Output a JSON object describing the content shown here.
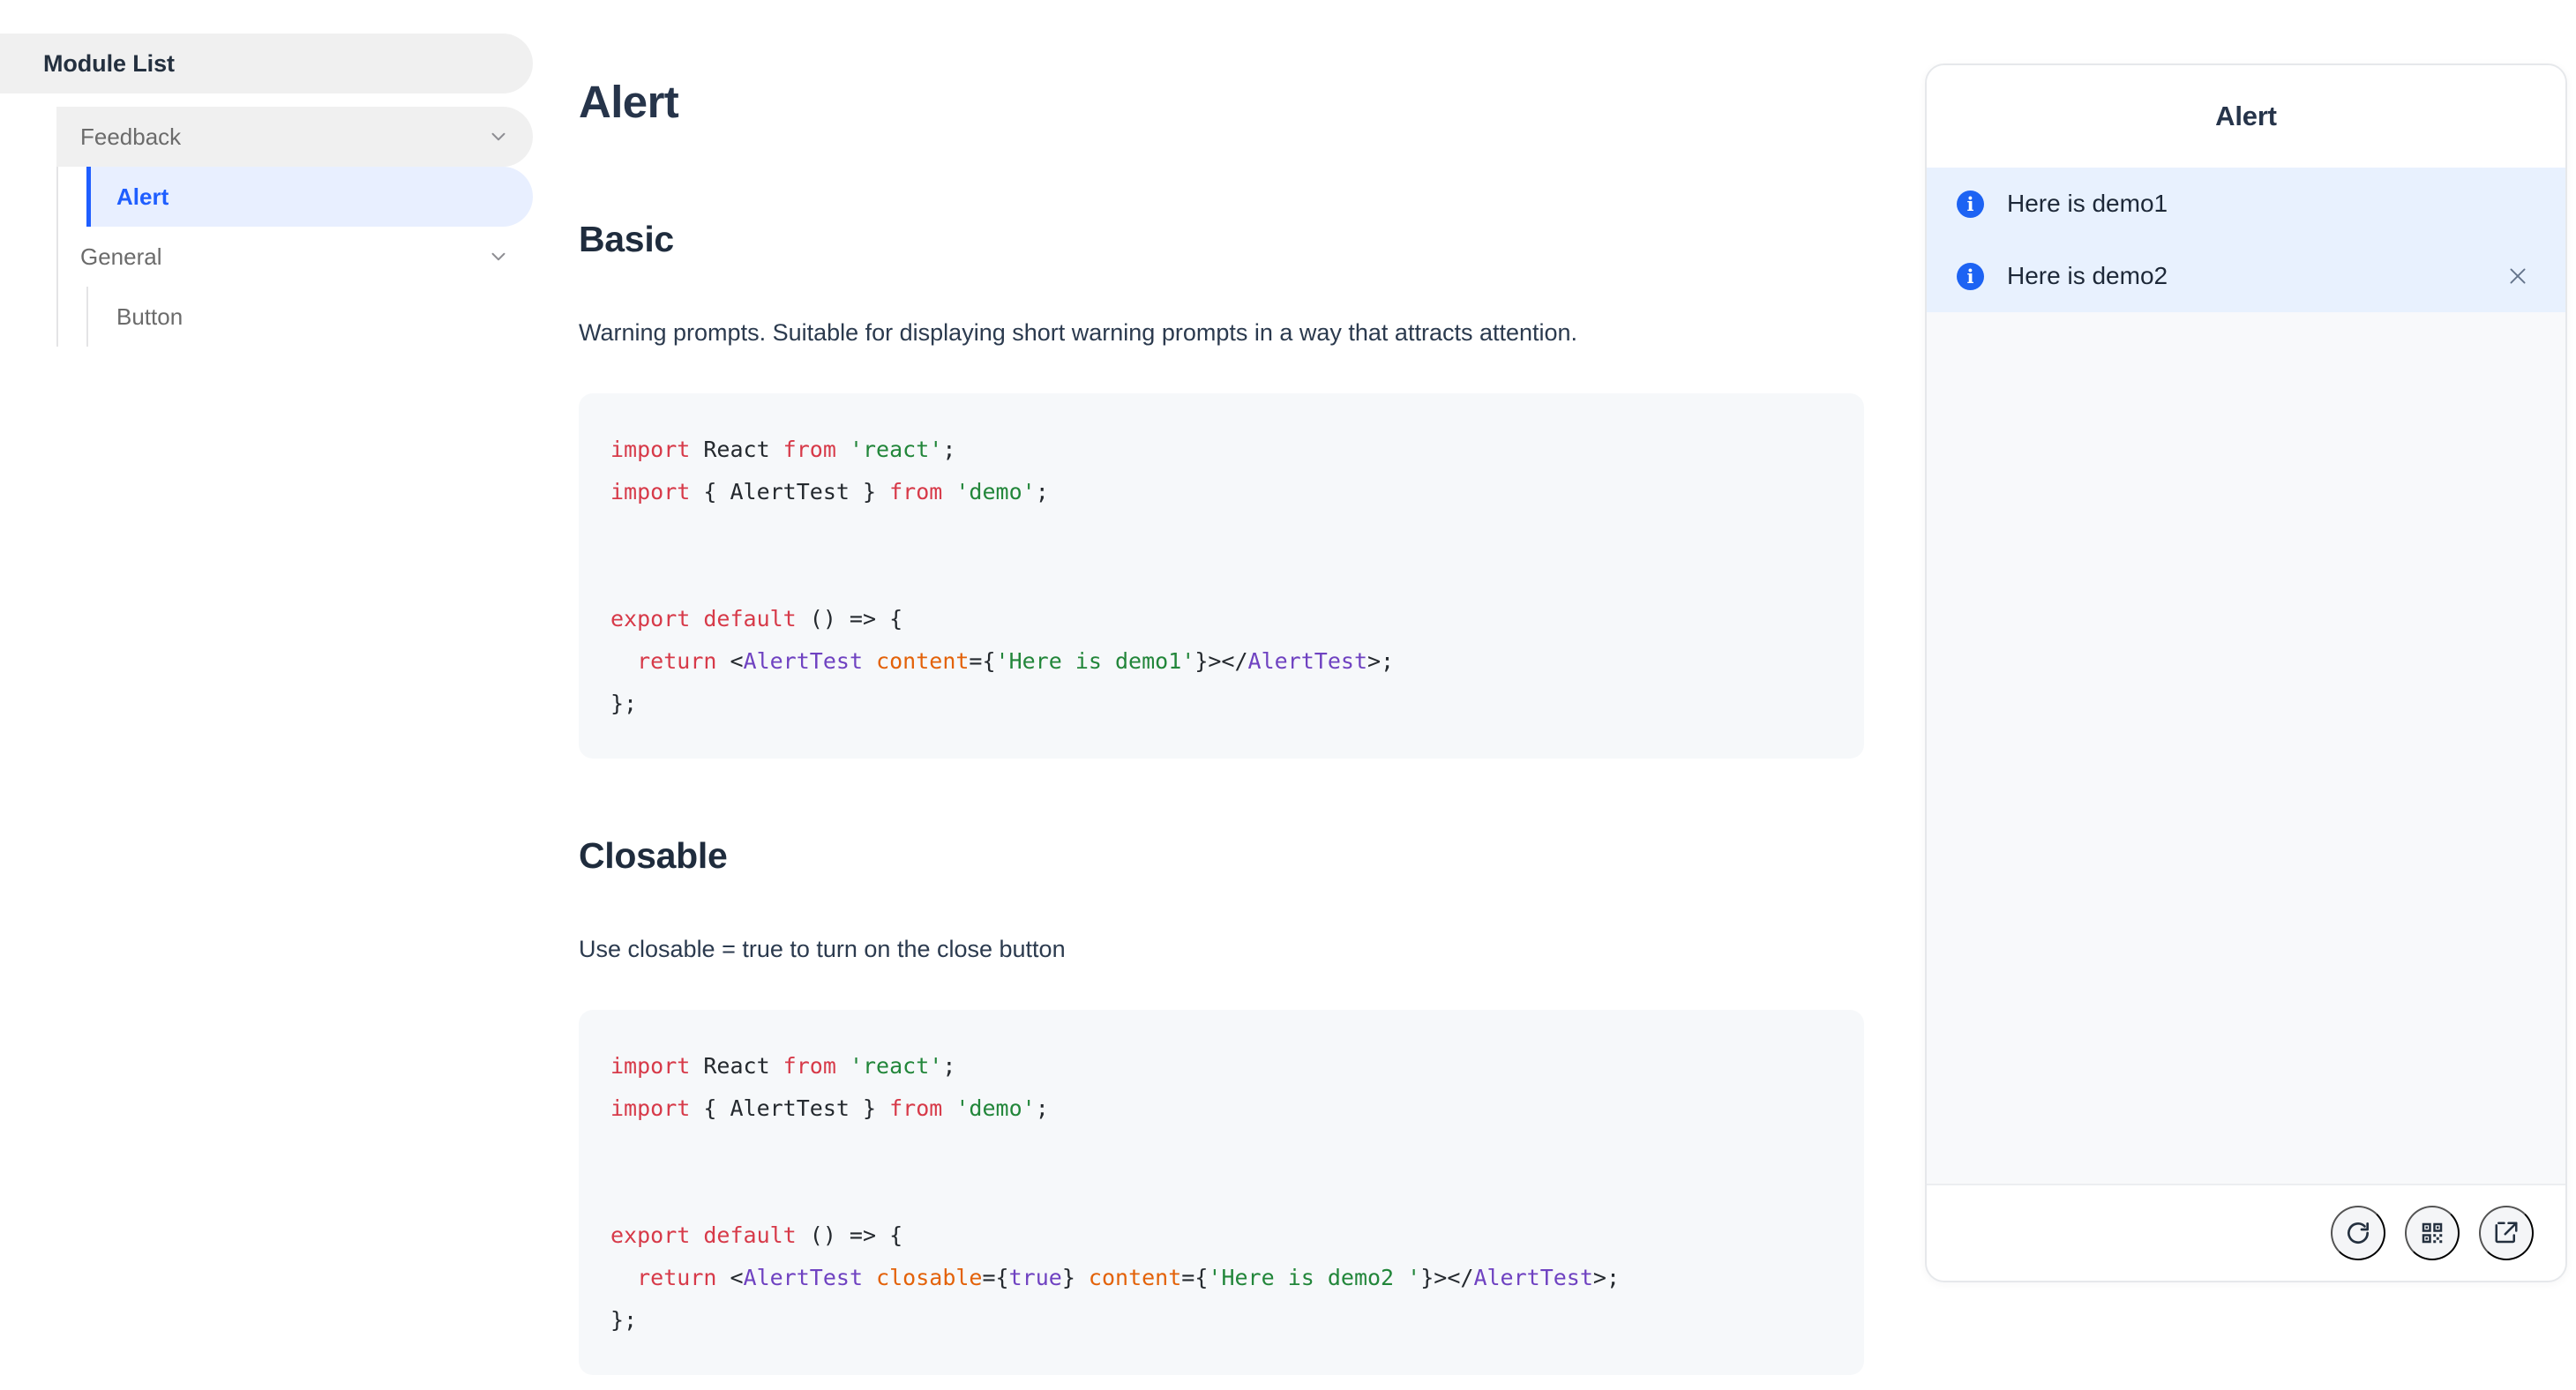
{
  "sidebar": {
    "title": "Module List",
    "groups": [
      {
        "label": "Feedback",
        "chevron_icon": "chevron-down-icon",
        "expanded": true,
        "children": [
          {
            "label": "Alert",
            "selected": true
          }
        ]
      },
      {
        "label": "General",
        "chevron_icon": "chevron-down-icon",
        "expanded": true,
        "children": [
          {
            "label": "Button",
            "selected": false
          }
        ]
      }
    ]
  },
  "main": {
    "page_title": "Alert",
    "sections": [
      {
        "title": "Basic",
        "description": "Warning prompts. Suitable for displaying short warning prompts in a way that attracts attention.",
        "code_lines": [
          [
            {
              "t": "import",
              "c": "kw"
            },
            {
              "t": " React ",
              "c": "pun"
            },
            {
              "t": "from",
              "c": "kw"
            },
            {
              "t": " ",
              "c": "pun"
            },
            {
              "t": "'react'",
              "c": "str"
            },
            {
              "t": ";",
              "c": "pun"
            }
          ],
          [
            {
              "t": "import",
              "c": "kw"
            },
            {
              "t": " { AlertTest } ",
              "c": "pun"
            },
            {
              "t": "from",
              "c": "kw"
            },
            {
              "t": " ",
              "c": "pun"
            },
            {
              "t": "'demo'",
              "c": "str"
            },
            {
              "t": ";",
              "c": "pun"
            }
          ],
          [],
          [],
          [
            {
              "t": "export default",
              "c": "kw"
            },
            {
              "t": " () => {",
              "c": "pun"
            }
          ],
          [
            {
              "t": "  ",
              "c": "pun"
            },
            {
              "t": "return",
              "c": "kw"
            },
            {
              "t": " <",
              "c": "pun"
            },
            {
              "t": "AlertTest",
              "c": "tag"
            },
            {
              "t": " ",
              "c": "pun"
            },
            {
              "t": "content",
              "c": "att"
            },
            {
              "t": "={",
              "c": "pun"
            },
            {
              "t": "'Here is demo1'",
              "c": "str"
            },
            {
              "t": "}></",
              "c": "pun"
            },
            {
              "t": "AlertTest",
              "c": "tag"
            },
            {
              "t": ">;",
              "c": "pun"
            }
          ],
          [
            {
              "t": "};",
              "c": "pun"
            }
          ]
        ]
      },
      {
        "title": "Closable",
        "description": "Use closable = true to turn on the close button",
        "code_lines": [
          [
            {
              "t": "import",
              "c": "kw"
            },
            {
              "t": " React ",
              "c": "pun"
            },
            {
              "t": "from",
              "c": "kw"
            },
            {
              "t": " ",
              "c": "pun"
            },
            {
              "t": "'react'",
              "c": "str"
            },
            {
              "t": ";",
              "c": "pun"
            }
          ],
          [
            {
              "t": "import",
              "c": "kw"
            },
            {
              "t": " { AlertTest } ",
              "c": "pun"
            },
            {
              "t": "from",
              "c": "kw"
            },
            {
              "t": " ",
              "c": "pun"
            },
            {
              "t": "'demo'",
              "c": "str"
            },
            {
              "t": ";",
              "c": "pun"
            }
          ],
          [],
          [],
          [
            {
              "t": "export default",
              "c": "kw"
            },
            {
              "t": " () => {",
              "c": "pun"
            }
          ],
          [
            {
              "t": "  ",
              "c": "pun"
            },
            {
              "t": "return",
              "c": "kw"
            },
            {
              "t": " <",
              "c": "pun"
            },
            {
              "t": "AlertTest",
              "c": "tag"
            },
            {
              "t": " ",
              "c": "pun"
            },
            {
              "t": "closable",
              "c": "att"
            },
            {
              "t": "={",
              "c": "pun"
            },
            {
              "t": "true",
              "c": "tag"
            },
            {
              "t": "} ",
              "c": "pun"
            },
            {
              "t": "content",
              "c": "att"
            },
            {
              "t": "={",
              "c": "pun"
            },
            {
              "t": "'Here is demo2 '",
              "c": "str"
            },
            {
              "t": "}></",
              "c": "pun"
            },
            {
              "t": "AlertTest",
              "c": "tag"
            },
            {
              "t": ">;",
              "c": "pun"
            }
          ],
          [
            {
              "t": "};",
              "c": "pun"
            }
          ]
        ]
      }
    ]
  },
  "preview": {
    "title": "Alert",
    "alerts": [
      {
        "icon": "info-icon",
        "glyph": "i",
        "text": "Here is demo1",
        "closable": false
      },
      {
        "icon": "info-icon",
        "glyph": "i",
        "text": "Here is demo2",
        "closable": true
      }
    ],
    "footer_buttons": [
      {
        "name": "refresh-icon",
        "label": "Refresh"
      },
      {
        "name": "qr-code-icon",
        "label": "QR code"
      },
      {
        "name": "external-link-icon",
        "label": "Open in new window"
      }
    ]
  },
  "colors": {
    "accent_blue": "#1f5eff",
    "info_blue": "#1d63f3",
    "alert_bg": "#e8f1fe",
    "selected_bg": "#e8efff",
    "sidebar_hl": "#f0f0f0",
    "code_bg": "#f6f8fa",
    "heading": "#26344a",
    "keyword": "#d73a49",
    "string": "#22863a",
    "tag": "#6f42c1",
    "attribute": "#e36209"
  }
}
